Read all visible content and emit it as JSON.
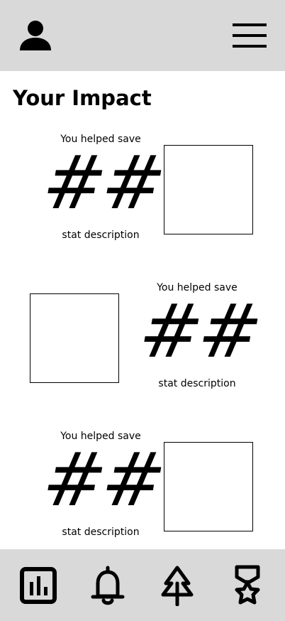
{
  "header": {
    "profile_icon": "person-icon",
    "menu_icon": "hamburger-menu-icon"
  },
  "page": {
    "title": "Your Impact"
  },
  "stats": [
    {
      "kicker": "You helped save",
      "value": "##",
      "description": "stat description"
    },
    {
      "kicker": "You helped save",
      "value": "##",
      "description": "stat description"
    },
    {
      "kicker": "You helped save",
      "value": "##",
      "description": "stat description"
    }
  ],
  "bottom_nav": {
    "items": [
      {
        "icon": "bar-chart-icon"
      },
      {
        "icon": "bell-icon"
      },
      {
        "icon": "tree-icon"
      },
      {
        "icon": "medal-star-icon"
      }
    ]
  },
  "colors": {
    "bar_background": "#d9d9d9",
    "page_background": "#ffffff",
    "foreground": "#000000"
  }
}
